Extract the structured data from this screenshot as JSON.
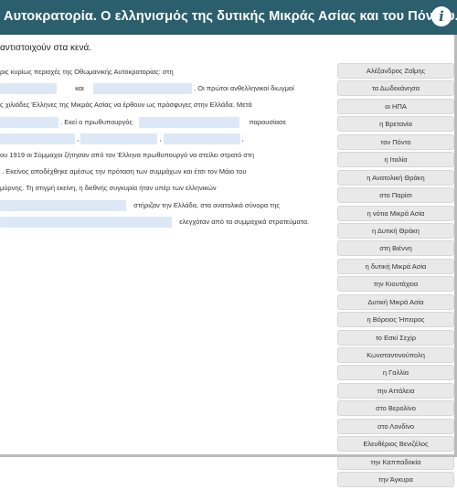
{
  "header": {
    "title": "Αυτοκρατορία. Ο ελληνισμός της δυτικής Μικράς Ασίας και του Πόντου.",
    "info_icon": "info-icon"
  },
  "instructions": "αντιστοιχούν στα κενά.",
  "text": {
    "line1": "ρις κυρίως περιοχές της Οθωμανικής Αυτοκρατορίας: στη",
    "line2_a": "και",
    "line2_b": ". Οι πρώτοι ανθελληνικοί διωγμοί",
    "line3": "ς χιλιάδες Έλληνες της Μικράς Ασίας να έρθουν ως πρόσφυγες στην Ελλάδα. Μετά",
    "line4_a": ". Εκεί ο πρωθυπουργός",
    "line4_b": "παρουσίασε",
    "line5_a": ",",
    "line5_b": ",",
    "line5_c": ",",
    "line6": "ου 1919 οι Σύμμαχοι ζήτησαν από τον Έλληνα πρωθυπουργό να στείλει στρατό στη",
    "line7": ". Εκείνος αποδέχθηκε αμέσως την πρόταση των συμμάχων και έτσι τον Μάιο του",
    "line8": "μύρνης. Τη στιγμή εκείνη, η διεθνής συγκυρία ήταν υπέρ των ελληνικών",
    "line9_a": "στήριζαν την Ελλάδα, στα ανατολικά σύνορα της",
    "line10_a": "ελεγχόταν από τα συμμαχικά στρατεύματα."
  },
  "options": [
    "Αλέξανδρος Ζαΐμης",
    "τα Δωδεκάνησα",
    "οι ΗΠΑ",
    "η Βρετανία",
    "τον Πόντο",
    "η Ιταλία",
    "η Ανατολική Θράκη",
    "στο Παρίσι",
    "η νότια Μικρά Ασία",
    "η Δυτική Θράκη",
    "στη Βιέννη",
    "η δυτική Μικρά Ασία",
    "την Κιουτάχεια",
    "Δυτική Μικρά Ασία",
    "η Βόρειος Ήπειρος",
    "το Εσκί Σεχίρ",
    "Κωνσταντινούπολη",
    "η Γαλλία",
    "την Αττάλεια",
    "στο Βερολίνο",
    "στο Λονδίνο",
    "Ελευθέριος Βενιζέλος",
    "την Καππαδοκία",
    "την Άγκυρα"
  ]
}
